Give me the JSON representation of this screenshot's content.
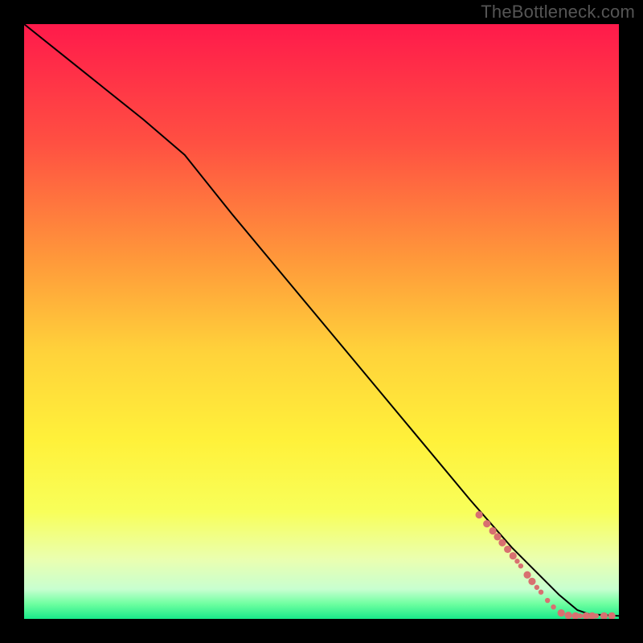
{
  "watermark": "TheBottleneck.com",
  "chart_data": {
    "type": "line",
    "title": "",
    "xlabel": "",
    "ylabel": "",
    "xlim": [
      0,
      100
    ],
    "ylim": [
      0,
      100
    ],
    "grid": false,
    "background_gradient_stops": [
      {
        "offset": 0.0,
        "color": "#ff1a4b"
      },
      {
        "offset": 0.2,
        "color": "#ff5042"
      },
      {
        "offset": 0.4,
        "color": "#ff9a3a"
      },
      {
        "offset": 0.55,
        "color": "#ffd23a"
      },
      {
        "offset": 0.7,
        "color": "#fff13a"
      },
      {
        "offset": 0.82,
        "color": "#f8ff5a"
      },
      {
        "offset": 0.9,
        "color": "#eaffb0"
      },
      {
        "offset": 0.95,
        "color": "#c8ffd0"
      },
      {
        "offset": 0.975,
        "color": "#6effa0"
      },
      {
        "offset": 1.0,
        "color": "#19e98a"
      }
    ],
    "series": [
      {
        "name": "bottleneck-curve",
        "color": "#000000",
        "x": [
          0,
          10,
          20,
          27,
          35,
          45,
          55,
          65,
          75,
          82,
          86,
          90,
          93,
          95,
          100
        ],
        "y": [
          100,
          92,
          84,
          78,
          68,
          56,
          44,
          32,
          20,
          12,
          8,
          4,
          1.5,
          0.8,
          0.5
        ]
      }
    ],
    "scatter": {
      "name": "sample-points",
      "color": "#d87070",
      "radius_small": 3.2,
      "radius_large": 4.6,
      "points": [
        {
          "x": 76.5,
          "y": 17.5,
          "r": "large"
        },
        {
          "x": 77.8,
          "y": 16.0,
          "r": "large"
        },
        {
          "x": 78.8,
          "y": 14.8,
          "r": "large"
        },
        {
          "x": 79.6,
          "y": 13.8,
          "r": "large"
        },
        {
          "x": 80.4,
          "y": 12.8,
          "r": "large"
        },
        {
          "x": 81.3,
          "y": 11.7,
          "r": "large"
        },
        {
          "x": 82.2,
          "y": 10.6,
          "r": "large"
        },
        {
          "x": 82.9,
          "y": 9.7,
          "r": "small"
        },
        {
          "x": 83.5,
          "y": 8.9,
          "r": "small"
        },
        {
          "x": 84.6,
          "y": 7.4,
          "r": "large"
        },
        {
          "x": 85.4,
          "y": 6.3,
          "r": "large"
        },
        {
          "x": 86.2,
          "y": 5.3,
          "r": "small"
        },
        {
          "x": 86.9,
          "y": 4.5,
          "r": "small"
        },
        {
          "x": 88.0,
          "y": 3.1,
          "r": "small"
        },
        {
          "x": 89.0,
          "y": 2.0,
          "r": "small"
        },
        {
          "x": 90.3,
          "y": 1.0,
          "r": "large"
        },
        {
          "x": 91.5,
          "y": 0.6,
          "r": "large"
        },
        {
          "x": 92.7,
          "y": 0.5,
          "r": "large"
        },
        {
          "x": 93.5,
          "y": 0.5,
          "r": "small"
        },
        {
          "x": 94.5,
          "y": 0.5,
          "r": "large"
        },
        {
          "x": 95.5,
          "y": 0.5,
          "r": "large"
        },
        {
          "x": 96.2,
          "y": 0.5,
          "r": "small"
        },
        {
          "x": 97.5,
          "y": 0.5,
          "r": "large"
        },
        {
          "x": 98.8,
          "y": 0.5,
          "r": "large"
        }
      ]
    }
  }
}
